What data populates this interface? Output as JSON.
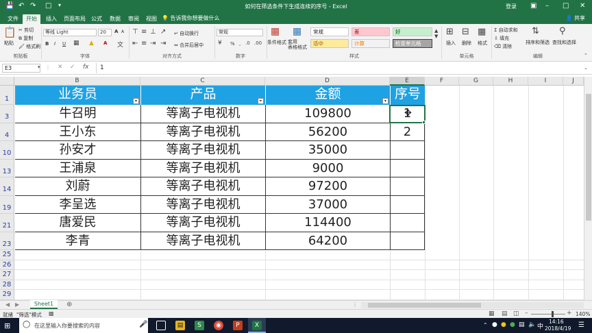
{
  "window": {
    "title": "如何在筛选条件下生成连续的序号 - Excel",
    "login": "登录",
    "share": "共享",
    "colors": {
      "brand": "#217346",
      "header_fill": "#1fa2e3",
      "taskbar": "#101a2c"
    }
  },
  "quick_access": {
    "save_icon": "save-icon",
    "undo_icon": "undo-icon",
    "redo_icon": "redo-icon",
    "new_icon": "new-doc-icon"
  },
  "ribbon_tabs": [
    "文件",
    "开始",
    "插入",
    "页面布局",
    "公式",
    "数据",
    "审阅",
    "视图"
  ],
  "active_tab": "开始",
  "tell_me": "告诉我你想要做什么",
  "ribbon": {
    "clipboard": {
      "paste": "粘贴",
      "cut": "剪切",
      "copy": "复制",
      "format_painter": "格式刷",
      "group": "剪贴板"
    },
    "font": {
      "name": "等线 Light",
      "size": "20",
      "bold": "B",
      "italic": "I",
      "underline": "U",
      "grow": "A",
      "shrink": "A",
      "color": "A",
      "group": "字体"
    },
    "alignment": {
      "wrap": "自动换行",
      "merge": "合并后居中",
      "group": "对齐方式"
    },
    "number": {
      "format": "常规",
      "percent": "%",
      "comma": ",",
      "group": "数字"
    },
    "styles": {
      "conditional": "条件格式",
      "table": "套用\n表格格式",
      "cells": [
        {
          "label": "常规",
          "bg": "#ffffff",
          "fg": "#222222"
        },
        {
          "label": "差",
          "bg": "#ffc7ce",
          "fg": "#9c0006"
        },
        {
          "label": "好",
          "bg": "#c6efce",
          "fg": "#006100"
        },
        {
          "label": "适中",
          "bg": "#ffeb9c",
          "fg": "#9c5700"
        },
        {
          "label": "计算",
          "bg": "#f2f2f2",
          "fg": "#fa7d00"
        },
        {
          "label": "检查单元格",
          "bg": "#a5a5a5",
          "fg": "#ffffff"
        }
      ],
      "group": "样式"
    },
    "cells": {
      "insert": "插入",
      "delete": "删除",
      "format": "格式",
      "group": "单元格"
    },
    "editing": {
      "autosum": "自动求和",
      "fill": "填充",
      "clear": "清除",
      "sort": "排序和筛选",
      "find": "查找和选择",
      "group": "编辑"
    }
  },
  "formula_bar": {
    "name_box": "E3",
    "fx": "fx",
    "value": "1"
  },
  "grid": {
    "columns": [
      "B",
      "C",
      "D",
      "E",
      "F",
      "G",
      "H",
      "I",
      "J"
    ],
    "header_row": {
      "row": "1",
      "cells": [
        "业务员",
        "产品",
        "金额",
        "序号"
      ]
    },
    "rows": [
      {
        "row": "3",
        "name": "牛召明",
        "product": "等离子电视机",
        "amount": "109800",
        "seq": "1"
      },
      {
        "row": "4",
        "name": "王小东",
        "product": "等离子电视机",
        "amount": "56200",
        "seq": "2"
      },
      {
        "row": "10",
        "name": "孙安才",
        "product": "等离子电视机",
        "amount": "35000",
        "seq": ""
      },
      {
        "row": "13",
        "name": "王浦泉",
        "product": "等离子电视机",
        "amount": "9000",
        "seq": ""
      },
      {
        "row": "14",
        "name": "刘蔚",
        "product": "等离子电视机",
        "amount": "97200",
        "seq": ""
      },
      {
        "row": "19",
        "name": "李呈选",
        "product": "等离子电视机",
        "amount": "37000",
        "seq": ""
      },
      {
        "row": "21",
        "name": "唐爱民",
        "product": "等离子电视机",
        "amount": "114400",
        "seq": ""
      },
      {
        "row": "23",
        "name": "李青",
        "product": "等离子电视机",
        "amount": "64200",
        "seq": ""
      }
    ],
    "empty_rows": [
      "25",
      "26",
      "27",
      "28",
      "29"
    ]
  },
  "sheet_tabs": [
    "Sheet1"
  ],
  "status": {
    "mode": "就绪",
    "filter_mode": "\"筛选\"模式",
    "zoom": "140%"
  },
  "taskbar": {
    "search_placeholder": "在这里输入你要搜索的内容",
    "time": "14:16",
    "date": "2018/4/19"
  }
}
